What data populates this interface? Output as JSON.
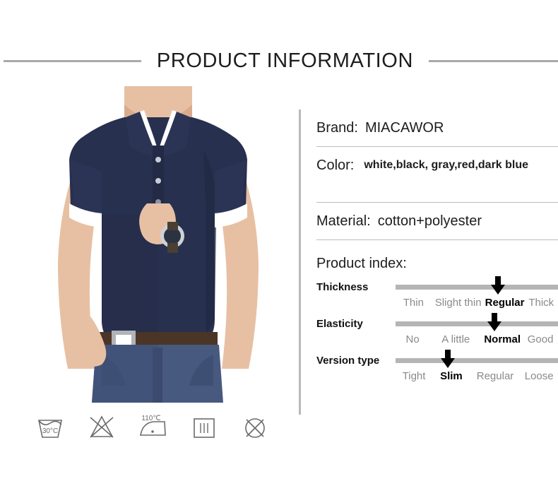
{
  "header": {
    "title": "PRODUCT INFORMATION"
  },
  "photo": {
    "alt": "man-wearing-navy-polo-shirt",
    "shirt_color": "#27304f",
    "trim_color": "#ffffff",
    "jeans_color": "#47597f",
    "belt_color": "#4a3526",
    "skin_color": "#e7c0a3"
  },
  "care_symbols": [
    {
      "name": "wash-30c-icon",
      "label": "30°C"
    },
    {
      "name": "do-not-bleach-icon",
      "label": ""
    },
    {
      "name": "iron-110c-icon",
      "label": "110℃"
    },
    {
      "name": "drip-dry-icon",
      "label": ""
    },
    {
      "name": "do-not-dry-clean-icon",
      "label": ""
    }
  ],
  "info": {
    "brand": {
      "label": "Brand:",
      "value": "MIACAWOR"
    },
    "color": {
      "label": "Color:",
      "value": "white,black, gray,red,dark blue"
    },
    "material": {
      "label": "Material:",
      "value": "cotton+polyester"
    }
  },
  "product_index": {
    "title": "Product index:",
    "rows": [
      {
        "label": "Thickness",
        "ticks": [
          "Thin",
          "Slight thin",
          "Regular",
          "Thick"
        ],
        "selected": 2,
        "selected_value": "Regular"
      },
      {
        "label": "Elasticity",
        "ticks": [
          "No",
          "A little",
          "Normal",
          "Good"
        ],
        "selected": 2,
        "selected_value": "Normal"
      },
      {
        "label": "Version type",
        "ticks": [
          "Tight",
          "Slim",
          "Regular",
          "Loose"
        ],
        "selected": 1,
        "selected_value": "Slim"
      }
    ]
  },
  "colors": {
    "rule": "#a9a9a9",
    "track": "#b5b5b5",
    "tick_inactive": "#8a8a8a",
    "tick_active": "#000000",
    "divider": "#bdbdbd",
    "text": "#1d1d1d"
  }
}
